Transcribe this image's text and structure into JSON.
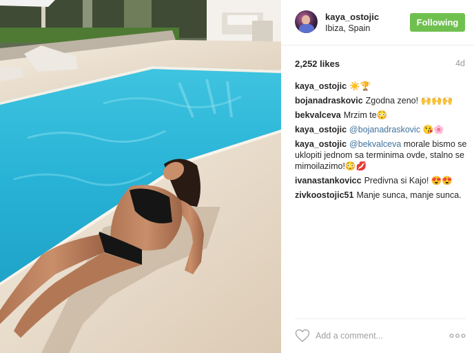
{
  "post": {
    "username": "kaya_ostojic",
    "location": "Ibiza, Spain",
    "follow_label": "Following",
    "likes": "2,252 likes",
    "age": "4d"
  },
  "comments": [
    {
      "user": "kaya_ostojic",
      "mention": "",
      "text": "☀️🏆"
    },
    {
      "user": "bojanadraskovic",
      "mention": "",
      "text": "Zgodna zeno! 🙌🙌🙌"
    },
    {
      "user": "bekvalceva",
      "mention": "",
      "text": "Mrzim te😳"
    },
    {
      "user": "kaya_ostojic",
      "mention": "@bojanadraskovic",
      "text": " 😘🌸"
    },
    {
      "user": "kaya_ostojic",
      "mention": "@bekvalceva",
      "text": " morale bismo se uklopiti jednom sa terminima ovde, stalno se mimoilazimo!😳💋"
    },
    {
      "user": "ivanastankovicc",
      "mention": "",
      "text": "Predivna si Kajo! 😍😍"
    },
    {
      "user": "zivkoostojic51",
      "mention": "",
      "text": "Manje sunca, manje sunca."
    }
  ],
  "footer": {
    "add_comment_placeholder": "Add a comment...",
    "like_icon": "heart-outline-icon",
    "more_icon": "more-options-icon"
  },
  "colors": {
    "follow_button": "#70c050",
    "mention": "#3f729b",
    "muted": "#999999"
  }
}
